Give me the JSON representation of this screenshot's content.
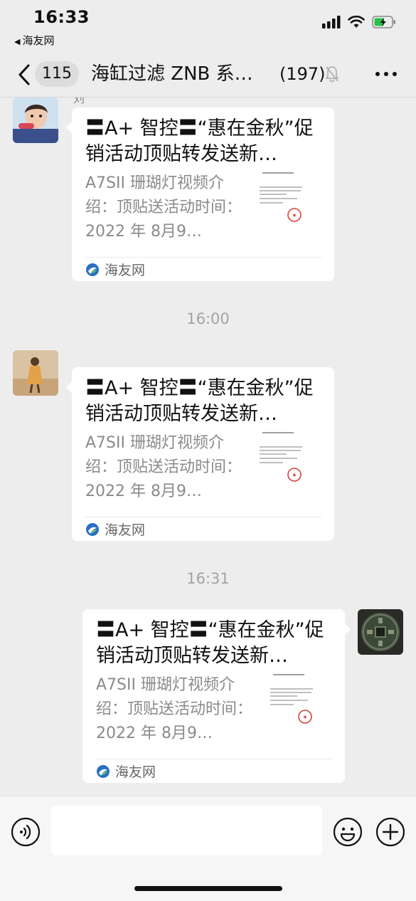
{
  "status_bar": {
    "time": "16:33",
    "back_app": "海友网"
  },
  "nav": {
    "unread_count": "115",
    "title": "海缸过滤 ZNB 系…",
    "member_count": "(197)",
    "muted": true
  },
  "messages": [
    {
      "direction": "left",
      "sender_name": "刘",
      "title": "〓A+ 智控〓“惠在金秋”促销活动顶贴转发送新…",
      "description": "A7SII 珊瑚灯视频介绍：顶贴送活动时间：2022 年 8月9…",
      "source": "海友网"
    },
    {
      "direction": "left",
      "sender_name": "",
      "title": "〓A+ 智控〓“惠在金秋”促销活动顶贴转发送新…",
      "description": "A7SII 珊瑚灯视频介绍：顶贴送活动时间：2022 年 8月9…",
      "source": "海友网"
    },
    {
      "direction": "right",
      "sender_name": "",
      "title": "〓A+ 智控〓“惠在金秋”促销活动顶贴转发送新…",
      "description": "A7SII 珊瑚灯视频介绍：顶贴送活动时间：2022 年 8月9…",
      "source": "海友网"
    }
  ],
  "timestamps": [
    "16:00",
    "16:31"
  ],
  "input": {
    "placeholder": ""
  },
  "colors": {
    "background": "#ededed",
    "card": "#ffffff",
    "time_label": "#a3a3a3",
    "source_logo": "#2a6fc2",
    "stamp": "#d0463a"
  },
  "icons": [
    "back-chevron-icon",
    "mute-bell-icon",
    "more-icon",
    "voice-icon",
    "emoji-icon",
    "plus-icon",
    "signal-icon",
    "wifi-icon",
    "battery-icon"
  ]
}
